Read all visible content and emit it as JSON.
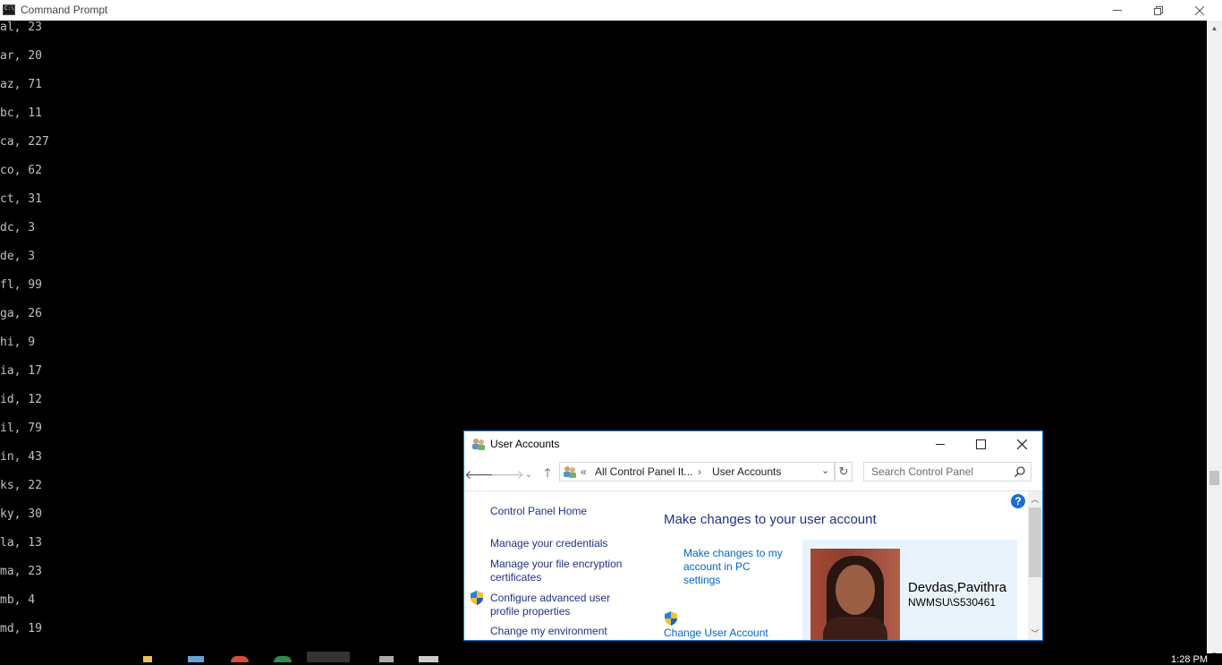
{
  "cmd": {
    "title": "Command Prompt",
    "lines": [
      "al, 23",
      "ar, 20",
      "az, 71",
      "bc, 11",
      "ca, 227",
      "co, 62",
      "ct, 31",
      "dc, 3",
      "de, 3",
      "fl, 99",
      "ga, 26",
      "hi, 9",
      "ia, 17",
      "id, 12",
      "il, 79",
      "in, 43",
      "ks, 22",
      "ky, 30",
      "la, 13",
      "ma, 23",
      "mb, 4",
      "md, 19"
    ]
  },
  "ua": {
    "title": "User Accounts",
    "breadcrumb": {
      "prefix": "«",
      "parent": "All Control Panel It...",
      "sep": "›",
      "current": "User Accounts"
    },
    "search_placeholder": "Search Control Panel",
    "left_links": {
      "home": "Control Panel Home",
      "credentials": "Manage your credentials",
      "encryption_1": "Manage your file encryption",
      "encryption_2": "certificates",
      "advanced_1": "Configure advanced user",
      "advanced_2": "profile properties",
      "env": "Change my environment"
    },
    "main_title": "Make changes to your user account",
    "links": {
      "pc_settings_1": "Make changes to my",
      "pc_settings_2": "account in PC",
      "pc_settings_3": "settings",
      "uac": "Change User Account"
    },
    "user": {
      "name": "Devdas,Pavithra",
      "id": "NWMSU\\S530461"
    }
  },
  "taskbar": {
    "clock": "1:28 PM"
  },
  "colors": {
    "accent": "#1883d7",
    "link": "#0066cc",
    "nav_link": "#1e3287"
  }
}
